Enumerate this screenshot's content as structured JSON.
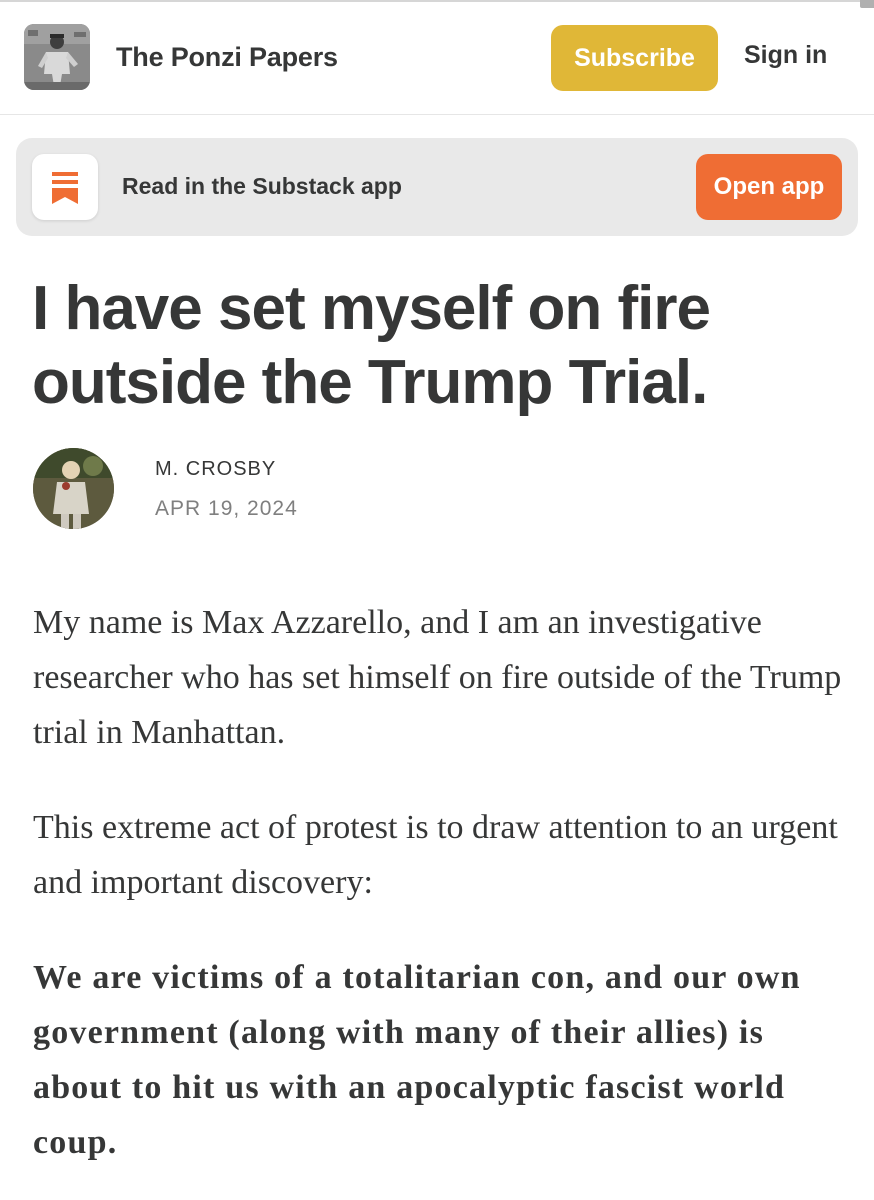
{
  "header": {
    "publication_name": "The Ponzi Papers",
    "subscribe_label": "Subscribe",
    "signin_label": "Sign in"
  },
  "app_banner": {
    "text": "Read in the Substack app",
    "open_label": "Open app"
  },
  "post": {
    "title": "I have set myself on fire outside the Trump Trial.",
    "author": "M. CROSBY",
    "date": "APR 19, 2024",
    "paragraphs": [
      "My name is Max Azzarello, and I am an investigative researcher who has set himself on fire outside of the Trump trial in Manhattan.",
      "This extreme act of protest is to draw attention to an urgent and important discovery:",
      "We are victims of a totalitarian con, and our own government (along with many of their allies) is about to hit us with an apocalyptic fascist world coup."
    ]
  },
  "colors": {
    "subscribe_button": "#e0b737",
    "open_app_button": "#ef6d34",
    "banner_background": "#e9e9e9",
    "text": "#363737",
    "muted_text": "#7f7f7f"
  },
  "icons": {
    "app_icon": "substack-logo-icon"
  }
}
